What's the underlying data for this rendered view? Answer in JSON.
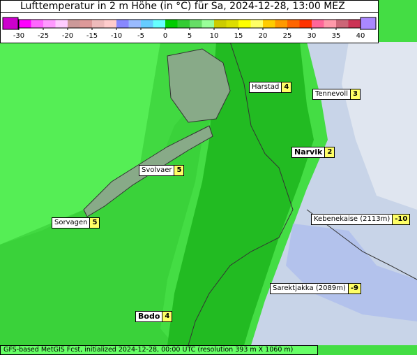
{
  "title": "Lufttemperatur in 2 m Höhe (in °C) für Sa, 2024-12-28, 13:00 MEZ",
  "legend": {
    "ticks": [
      "-30",
      "-25",
      "-20",
      "-15",
      "-10",
      "-5",
      "0",
      "5",
      "10",
      "15",
      "20",
      "25",
      "30",
      "35",
      "40"
    ],
    "colors": [
      "#ff00ff",
      "#ff66ff",
      "#ff99ff",
      "#ffccff",
      "#cc9999",
      "#dd9999",
      "#eebbbb",
      "#ffcccc",
      "#8888ff",
      "#99bbff",
      "#66ccff",
      "#66ffff",
      "#00cc00",
      "#33cc33",
      "#66dd66",
      "#99ff99",
      "#cccc00",
      "#dddd00",
      "#ffff00",
      "#ffff66",
      "#ffcc00",
      "#ff9900",
      "#ff6600",
      "#ff3300",
      "#ff6699",
      "#ff99aa",
      "#cc6677",
      "#cc3355"
    ],
    "low_color": "#cc00cc",
    "high_color": "#aa88ff"
  },
  "stations": [
    {
      "name": "Harstad",
      "value": "4",
      "bold": false
    },
    {
      "name": "Tennevoll",
      "value": "3",
      "bold": false
    },
    {
      "name": "Narvik",
      "value": "2",
      "bold": true
    },
    {
      "name": "Svolvaer",
      "value": "5",
      "bold": false
    },
    {
      "name": "Sorvagen",
      "value": "5",
      "bold": false
    },
    {
      "name": "Kebenekaise (2113m)",
      "value": "-10",
      "bold": false
    },
    {
      "name": "Sarektjakka (2089m)",
      "value": "-9",
      "bold": false
    },
    {
      "name": "Bodo",
      "value": "4",
      "bold": true
    }
  ],
  "footer": "GFS-based MetGIS Fcst, initialized 2024-12-28, 00:00 UTC  (resolution 393 m X 1060 m)"
}
